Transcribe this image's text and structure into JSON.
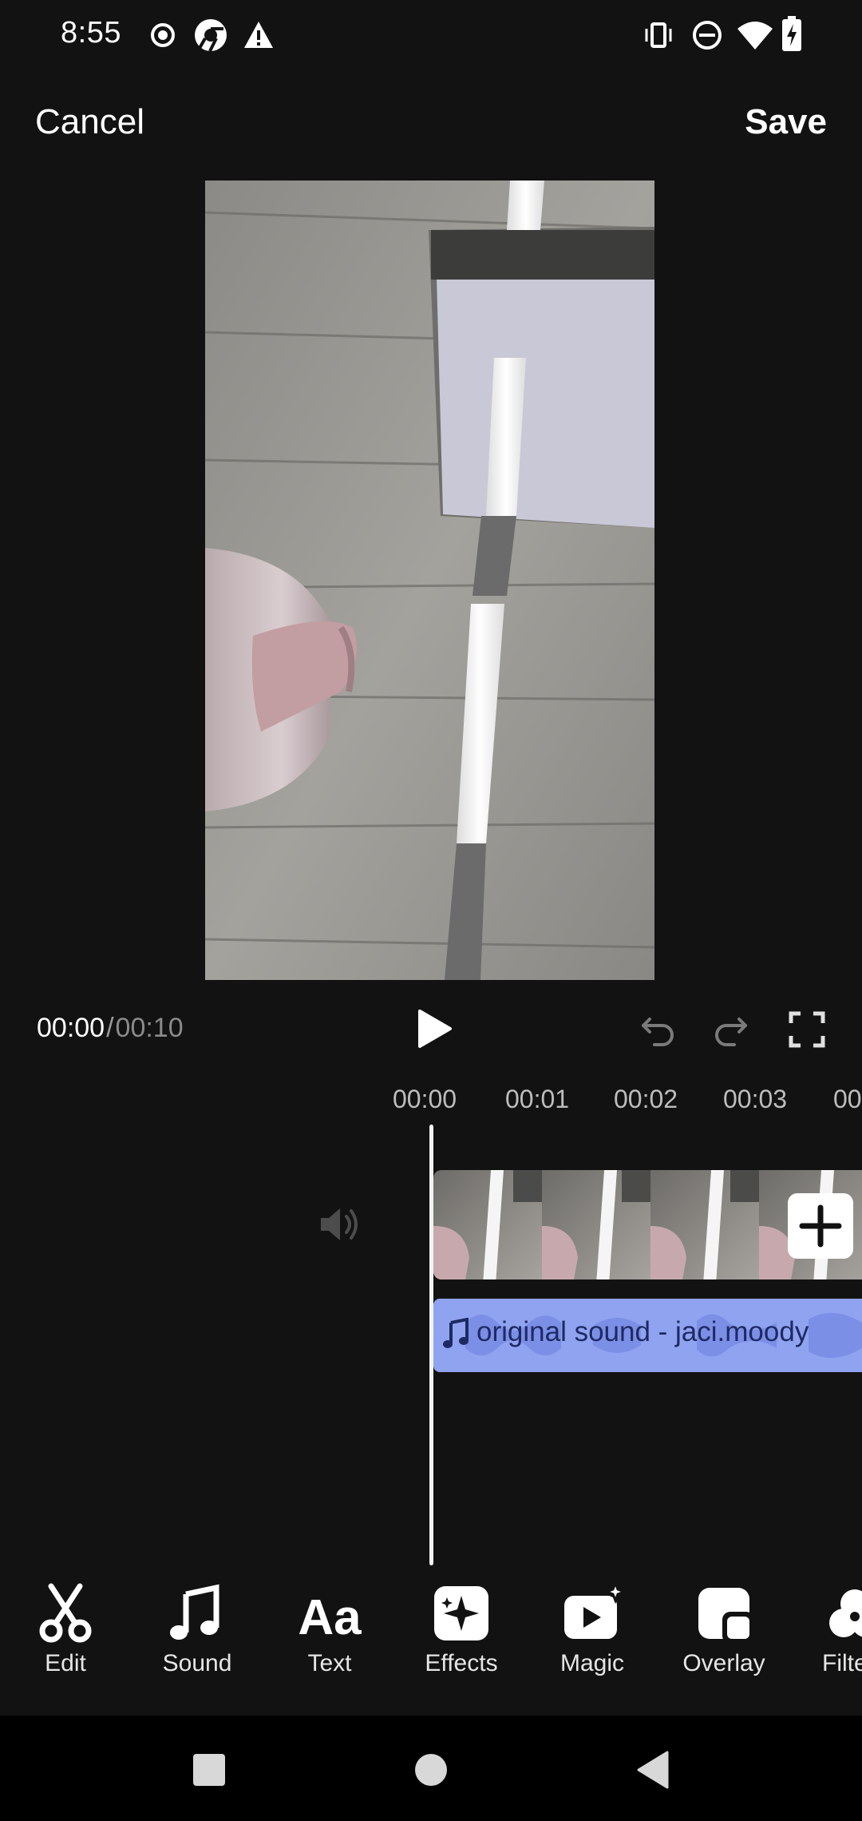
{
  "status_bar": {
    "time": "8:55",
    "left_icons": [
      "record-icon",
      "chrome-icon",
      "warning-icon"
    ],
    "right_icons": [
      "vibrate-icon",
      "do-not-disturb-icon",
      "wifi-icon",
      "battery-charging-icon"
    ]
  },
  "top_bar": {
    "cancel_label": "Cancel",
    "save_label": "Save"
  },
  "player": {
    "current_time": "00:00",
    "separator": "/",
    "total_time": "00:10"
  },
  "timeline": {
    "ruler": [
      "00:00",
      "00:01",
      "00:02",
      "00:03",
      "00"
    ],
    "sound_track_label": "original sound - jaci.moody"
  },
  "tools": [
    {
      "label": "Edit",
      "icon": "scissors-icon"
    },
    {
      "label": "Sound",
      "icon": "music-note-icon"
    },
    {
      "label": "Text",
      "icon": "text-icon"
    },
    {
      "label": "Effects",
      "icon": "sparkle-effects-icon"
    },
    {
      "label": "Magic",
      "icon": "magic-video-icon"
    },
    {
      "label": "Overlay",
      "icon": "overlay-icon"
    },
    {
      "label": "Filte",
      "icon": "filter-icon"
    }
  ],
  "colors": {
    "background": "#121212",
    "sound_track": "#8fa3f0",
    "sound_text": "#1e2a63",
    "nav_bar": "#000000"
  }
}
